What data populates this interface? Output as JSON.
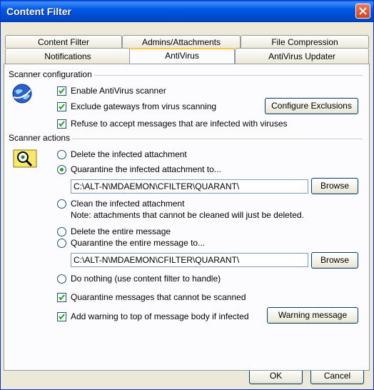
{
  "window": {
    "title": "Content Filter"
  },
  "tabs_row1": [
    {
      "label": "Content Filter"
    },
    {
      "label": "Admins/Attachments"
    },
    {
      "label": "File Compression"
    }
  ],
  "tabs_row2": [
    {
      "label": "Notifications"
    },
    {
      "label": "AntiVirus"
    },
    {
      "label": "AntiVirus Updater"
    }
  ],
  "scanner_config": {
    "group_label": "Scanner configuration",
    "enable_scanner": {
      "label": "Enable AntiVirus scanner",
      "checked": true
    },
    "exclude_gateways": {
      "label": "Exclude gateways from virus scanning",
      "checked": true
    },
    "configure_exclusions_label": "Configure Exclusions",
    "refuse_infected": {
      "label": "Refuse to accept messages that are infected with viruses",
      "checked": true
    }
  },
  "scanner_actions": {
    "group_label": "Scanner actions",
    "delete_attachment": {
      "label": "Delete the infected attachment",
      "selected": false
    },
    "quarantine_attachment": {
      "label": "Quarantine the infected attachment to...",
      "selected": true
    },
    "attachment_path": "C:\\ALT-N\\MDAEMON\\CFILTER\\QUARANT\\",
    "browse1_label": "Browse",
    "clean_attachment": {
      "label": "Clean the infected attachment",
      "selected": false
    },
    "clean_note": "Note: attachments that cannot be cleaned will just be deleted.",
    "delete_message": {
      "label": "Delete the entire message",
      "selected": false
    },
    "quarantine_message": {
      "label": "Quarantine the entire message to...",
      "selected": false
    },
    "message_path": "C:\\ALT-N\\MDAEMON\\CFILTER\\QUARANT\\",
    "browse2_label": "Browse",
    "do_nothing": {
      "label": "Do nothing (use content filter to handle)",
      "selected": false
    },
    "quarantine_unscannable": {
      "label": "Quarantine messages that cannot be scanned",
      "checked": true
    },
    "add_warning": {
      "label": "Add warning to top of message body if infected",
      "checked": true
    },
    "warning_message_label": "Warning message"
  },
  "footer": {
    "ok_label": "OK",
    "cancel_label": "Cancel"
  },
  "colors": {
    "titlebar": "#0058e6",
    "close": "#d1401a",
    "active_tab_accent": "#ffc73c",
    "radio_dot": "#21a121"
  },
  "icons": {
    "scanner_config": "globe-scan-icon",
    "scanner_actions": "magnifier-virus-icon",
    "close": "close-icon"
  }
}
